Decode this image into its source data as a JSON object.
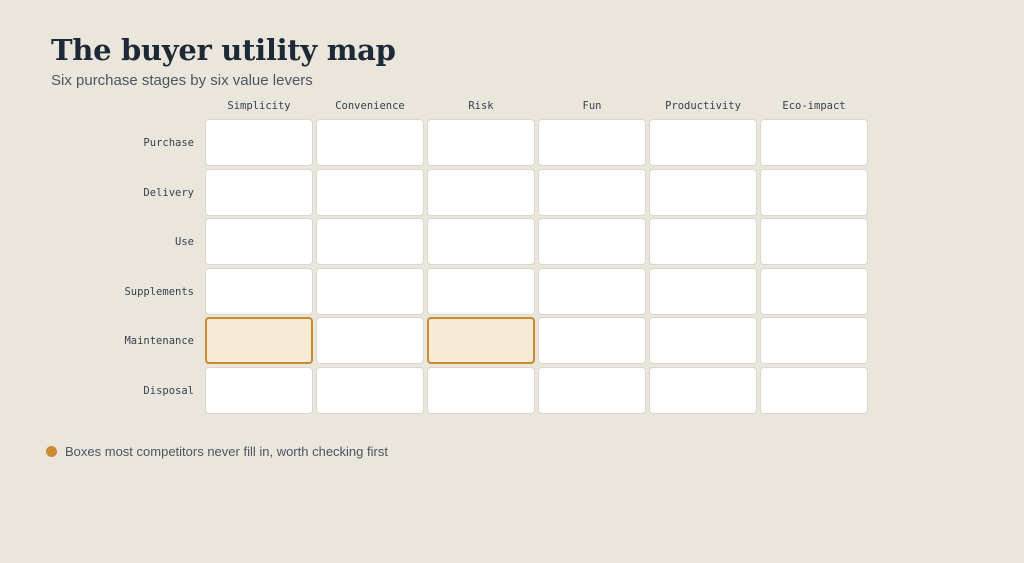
{
  "title": "The buyer utility map",
  "subtitle": "Six purchase stages by six value levers",
  "columns": [
    "Simplicity",
    "Convenience",
    "Risk",
    "Fun",
    "Productivity",
    "Eco-impact"
  ],
  "rows": [
    "Purchase",
    "Delivery",
    "Use",
    "Supplements",
    "Maintenance",
    "Disposal"
  ],
  "highlighted_cells": [
    {
      "row": "Maintenance",
      "column": "Simplicity"
    },
    {
      "row": "Maintenance",
      "column": "Risk"
    }
  ],
  "legend": {
    "text": "Boxes most competitors never fill in, worth checking first",
    "color": "#c98a30"
  },
  "colors": {
    "background": "#ebe6dc",
    "cell": "#ffffff",
    "highlight_fill": "#f7ead5",
    "highlight_border": "#c98a30"
  }
}
